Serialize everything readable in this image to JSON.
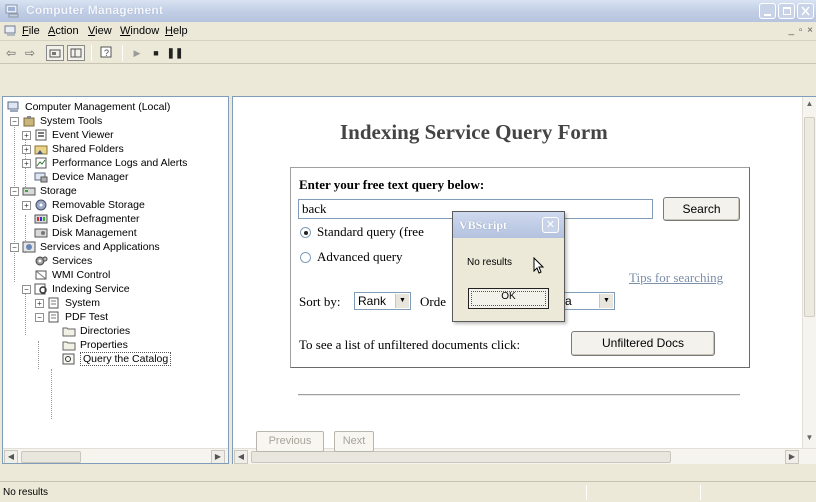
{
  "window": {
    "title": "Computer Management"
  },
  "menu": {
    "items": [
      "File",
      "Action",
      "View",
      "Window",
      "Help"
    ]
  },
  "tree": {
    "items": [
      {
        "label": "Computer Management (Local)"
      },
      {
        "label": "System Tools"
      },
      {
        "label": "Event Viewer"
      },
      {
        "label": "Shared Folders"
      },
      {
        "label": "Performance Logs and Alerts"
      },
      {
        "label": "Device Manager"
      },
      {
        "label": "Storage"
      },
      {
        "label": "Removable Storage"
      },
      {
        "label": "Disk Defragmenter"
      },
      {
        "label": "Disk Management"
      },
      {
        "label": "Services and Applications"
      },
      {
        "label": "Services"
      },
      {
        "label": "WMI Control"
      },
      {
        "label": "Indexing Service"
      },
      {
        "label": "System"
      },
      {
        "label": "PDF Test"
      },
      {
        "label": "Directories"
      },
      {
        "label": "Properties"
      },
      {
        "label": "Query the Catalog"
      }
    ]
  },
  "form": {
    "title": "Indexing Service Query Form",
    "prompt": "Enter your free text query below:",
    "query_value": "back",
    "search_label": "Search",
    "standard_label": "Standard query (free",
    "advanced_label": "Advanced query",
    "tips_label": "Tips for searching",
    "sort_label": "Sort by:",
    "sort_value": "Rank",
    "order_label": "Orde",
    "order_value": "a",
    "list_text": "To see a list of unfiltered documents click:",
    "unfiltered_label": "Unfiltered Docs",
    "previous_label": "Previous",
    "next_label": "Next"
  },
  "dialog": {
    "title": "VBScript",
    "message": "No results",
    "ok_label": "OK"
  },
  "status": {
    "text": "No results"
  }
}
